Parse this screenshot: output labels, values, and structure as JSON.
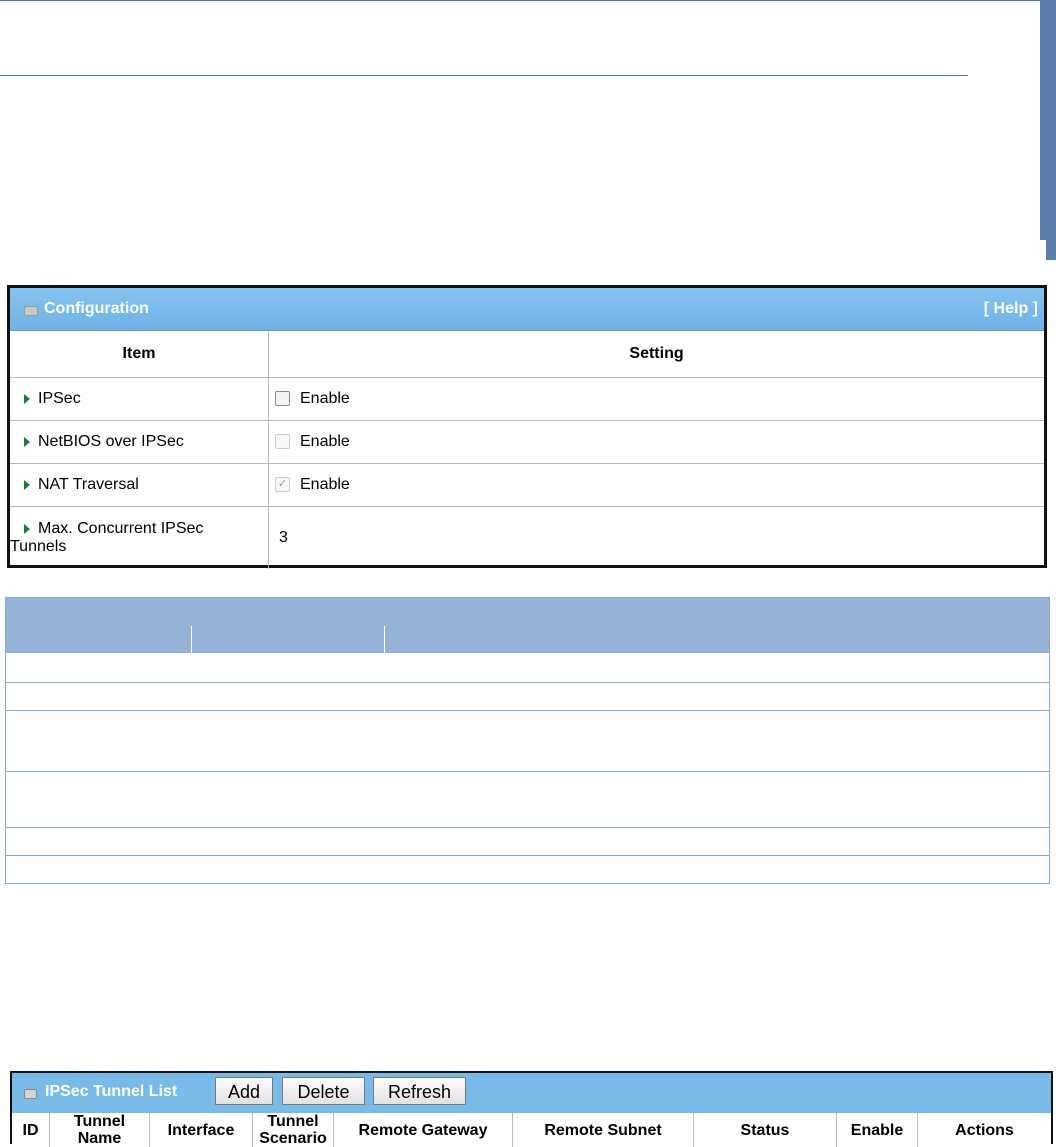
{
  "configuration": {
    "title": "Configuration",
    "help_label": "[ Help ]",
    "col_item": "Item",
    "col_setting": "Setting",
    "rows": [
      {
        "label": "IPSec",
        "setting": "Enable",
        "checkbox": "unchecked"
      },
      {
        "label": "NetBIOS over IPSec",
        "setting": "Enable",
        "checkbox": "disabled"
      },
      {
        "label": "NAT Traversal",
        "setting": "Enable",
        "checkbox": "checked-disabled"
      },
      {
        "label_line1": "Max. Concurrent IPSec",
        "label_line2": "Tunnels",
        "value": "3"
      }
    ]
  },
  "tunnel_list": {
    "title": "IPSec Tunnel List",
    "add_label": "Add",
    "delete_label": "Delete",
    "refresh_label": "Refresh",
    "columns": {
      "id": "ID",
      "tunnel_name_1": "Tunnel",
      "tunnel_name_2": "Name",
      "interface": "Interface",
      "scenario_1": "Tunnel",
      "scenario_2": "Scenario",
      "remote_gateway": "Remote Gateway",
      "remote_subnet": "Remote Subnet",
      "status": "Status",
      "enable": "Enable",
      "actions": "Actions"
    }
  },
  "colors": {
    "panel_header": "#78bbe9",
    "desc_header": "#95b3d7",
    "rule": "#4f7aa0"
  }
}
